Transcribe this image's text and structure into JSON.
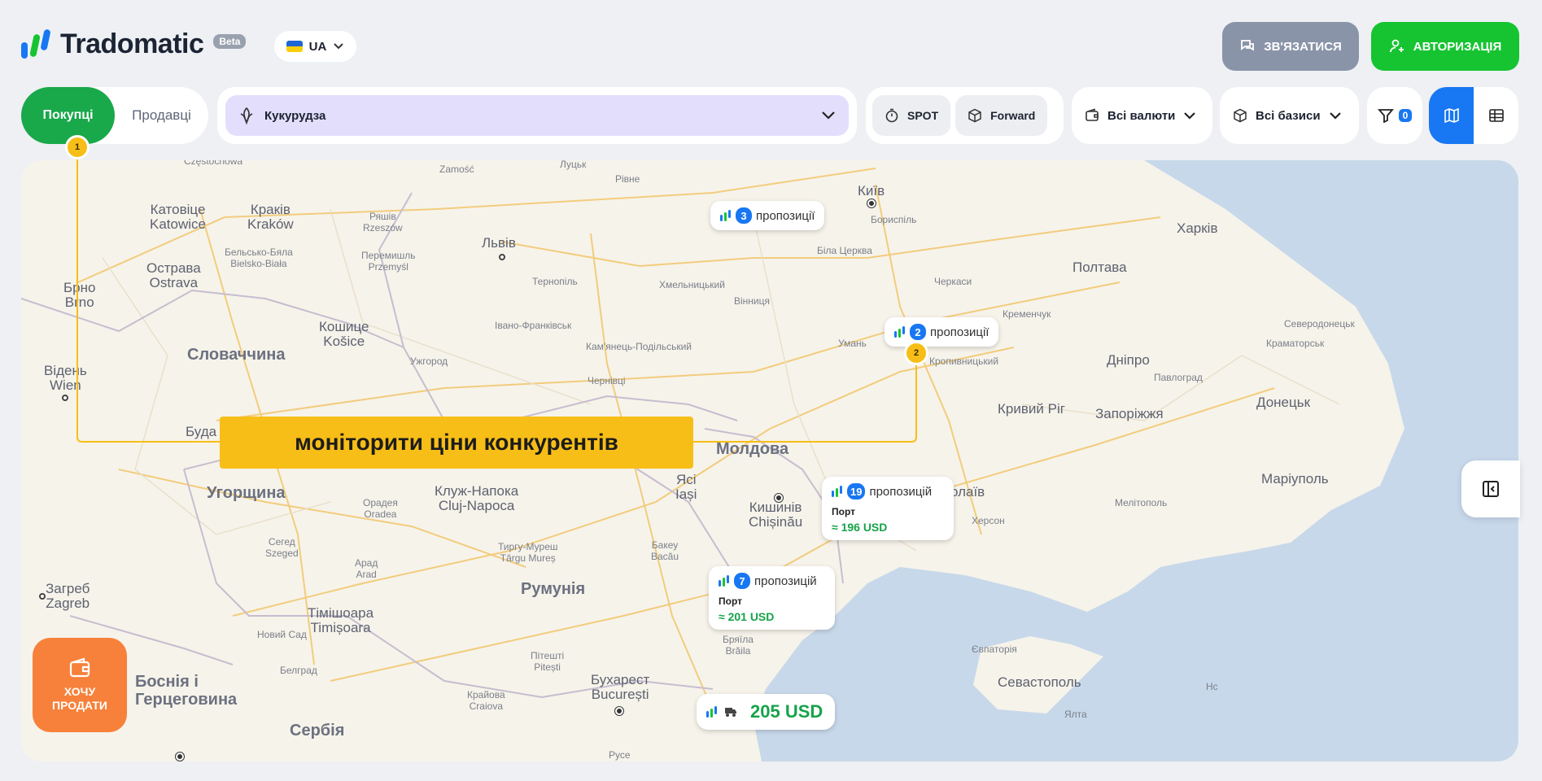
{
  "header": {
    "brand": "Tradomatic",
    "beta": "Beta",
    "language": "UA",
    "contact_label": "ЗВ'ЯЗАТИСЯ",
    "auth_label": "АВТОРИЗАЦІЯ"
  },
  "toolbar": {
    "role_tabs": [
      "Покупці",
      "Продавці"
    ],
    "role_selected": "Покупці",
    "commodity": "Кукурудза",
    "deal_types": [
      "SPOT",
      "Forward"
    ],
    "currency": "Всі валюти",
    "basis": "Всі базиси",
    "filter_count": "0",
    "view_mode": "map"
  },
  "map": {
    "countries": [
      "Словаччина",
      "Угорщина",
      "Молдова",
      "Румунія",
      "Сербія",
      "Боснія і Герцеговина"
    ],
    "cities": {
      "katowice": "Катовіце",
      "katowice_lat": "Katowice",
      "krakow": "Краків",
      "krakow_lat": "Kraków",
      "rzeszow": "Ряшів",
      "rzeszow_lat": "Rzeszów",
      "bielsko": "Бельсько-Бяла",
      "bielsko_lat": "Bielsko-Biała",
      "przemysl": "Перемишль",
      "przemysl_lat": "Przemyśl",
      "ostrava": "Острава",
      "ostrava_lat": "Ostrava",
      "brno": "Брно",
      "brno_lat": "Brno",
      "kosice": "Кошице",
      "kosice_lat": "Košice",
      "wien": "Відень",
      "wien_lat": "Wien",
      "uzhhorod": "Ужгород",
      "buda": "Буда",
      "kluj": "Клуж-Напока",
      "kluj_lat": "Cluj-Napoca",
      "oradea": "Орадея",
      "oradea_lat": "Oradea",
      "szeged": "Сегед",
      "szeged_lat": "Szeged",
      "arad": "Арад",
      "arad_lat": "Arad",
      "mures": "Тиргу-Муреш",
      "mures_lat": "Târgu Mureș",
      "timisoara": "Тімішоара",
      "timisoara_lat": "Timișoara",
      "novisad": "Новий Сад",
      "belgrade": "Белград",
      "zagreb": "Загреб",
      "zagreb_lat": "Zagreb",
      "lviv": "Львів",
      "lutsk": "Луцьк",
      "rivne": "Рівне",
      "zamosc": "Zamość",
      "ternopil": "Тернопіль",
      "khmelnytskyi": "Хмельницький",
      "vinnytsia": "Вінниця",
      "ivano": "Івано-Франківськ",
      "kamianets": "Кам'янець-Подільський",
      "chernivtsi": "Чернівці",
      "kyiv": "Київ",
      "boryspil": "Бориспіль",
      "bila": "Біла Церква",
      "cherkasy": "Черкаси",
      "kremenchuk": "Кременчук",
      "uman": "Умань",
      "kropyvnytskyi": "Кропивницький",
      "kharkiv": "Харків",
      "poltava": "Полтава",
      "sievierodonetsk": "Северодонецьк",
      "kramatorsk": "Краматорськ",
      "dnipro": "Дніпро",
      "pavlohrad": "Павлоград",
      "kryvyi": "Кривий Ріг",
      "zaporizhzhia": "Запоріжжя",
      "donetsk": "Донецьк",
      "mariupol": "Маріуполь",
      "melitopol": "Мелітополь",
      "kherson": "Херсон",
      "mykolaiv": "олаїв",
      "kishinev": "Кишинів",
      "kishinev_lat": "Chișinău",
      "iasi": "Ясі",
      "iasi_lat": "Iași",
      "bacau": "Бакеу",
      "bacau_lat": "Bacău",
      "pitesti": "Пітешті",
      "pitesti_lat": "Pitești",
      "braila": "Бряїла",
      "braila_lat": "Brăila",
      "craiova": "Крайова",
      "craiova_lat": "Craiova",
      "bucharest": "Бухарест",
      "bucharest_lat": "București",
      "ruse": "Русе",
      "yevpatoria": "Євпаторія",
      "sevastopol": "Севастополь",
      "yalta": "Ялта",
      "cz": "Częstochowa",
      "nc": "Нс"
    },
    "offers": [
      {
        "count": "3",
        "label": "пропозиції"
      },
      {
        "count": "2",
        "label": "пропозиції"
      },
      {
        "count": "19",
        "label": "пропозицій",
        "basis": "Порт",
        "price": "≈ 196 USD"
      },
      {
        "count": "7",
        "label": "пропозицій",
        "basis": "Порт",
        "price": "≈ 201 USD"
      }
    ],
    "price_pill": "205 USD"
  },
  "tour": {
    "message": "моніторити ціни конкурентів",
    "step1": "1",
    "step2": "2"
  },
  "sell_button": "ХОЧУ\nПРОДАТИ",
  "colors": {
    "primary_green": "#16c431",
    "tab_green": "#19a84a",
    "accent_blue": "#1877f2",
    "tour_yellow": "#f7be17",
    "sell_orange": "#f7813a",
    "sea": "#c5d6e8",
    "price_green": "#16a34a"
  }
}
